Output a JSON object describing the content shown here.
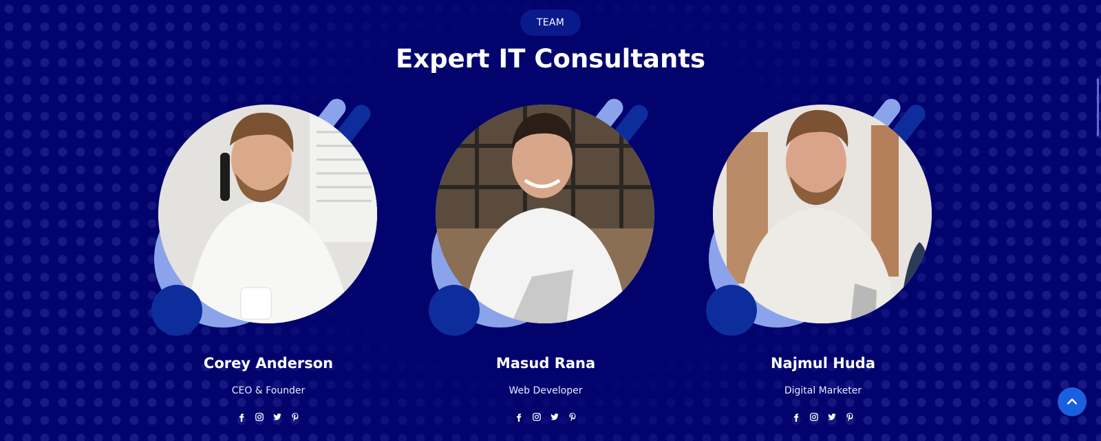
{
  "section": {
    "badge": "TEAM",
    "title": "Expert IT Consultants"
  },
  "team": [
    {
      "name": "Corey Anderson",
      "role": "CEO & Founder"
    },
    {
      "name": "Masud Rana",
      "role": "Web Developer"
    },
    {
      "name": "Najmul Huda",
      "role": "Digital Marketer"
    }
  ],
  "social_icons": [
    "facebook-icon",
    "instagram-icon",
    "twitter-icon",
    "pinterest-icon"
  ],
  "colors": {
    "background": "#03036e",
    "accent_light": "#8aa3ea",
    "accent_dark": "#0e2d9c",
    "button": "#1a5fe0"
  }
}
